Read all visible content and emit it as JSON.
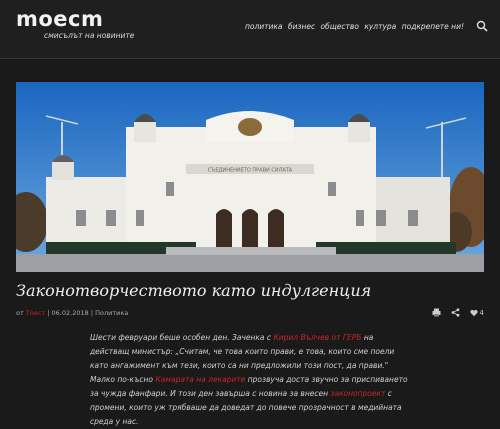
{
  "site": {
    "logo": "moecm",
    "tagline": "смисълът на новините"
  },
  "nav": {
    "items": [
      "политика",
      "бизнес",
      "общество",
      "култура",
      "подкрепете ни!"
    ]
  },
  "hero": {
    "building_inscription": "СЪЕДИНЕНИЕТО ПРАВИ СИЛАТА"
  },
  "article": {
    "title": "Законотворчеството като индулгенция",
    "by_label": "от",
    "author": "Тоест",
    "date": "06.02.2018",
    "category": "Политика",
    "likes": "4",
    "p1_a": "Шести февруари беше особен ден. Заченка с",
    "p1_link1": "Кирил Вълчев от ГЕРБ",
    "p1_b": "на действащ министър: „Считам, че това които прави, е това, които сме поели като ангажимент към тези, които са ни предложили този пост, да прави.\" Малко по-късно",
    "p1_link2": "Камарата на лекарите",
    "p1_c": "прозвуча доста звучно за приспиването за чужда фанфари. И този ден завърша с новина за внесен",
    "p1_link3": "законопроект",
    "p1_d": "с промени, които уж трябваше да доведат до повече прозрачност в медийната среда у нас."
  },
  "colors": {
    "accent": "#c1272d",
    "background": "#1a1a1a"
  },
  "icons": [
    "search-icon",
    "print-icon",
    "share-icon",
    "heart-icon"
  ]
}
